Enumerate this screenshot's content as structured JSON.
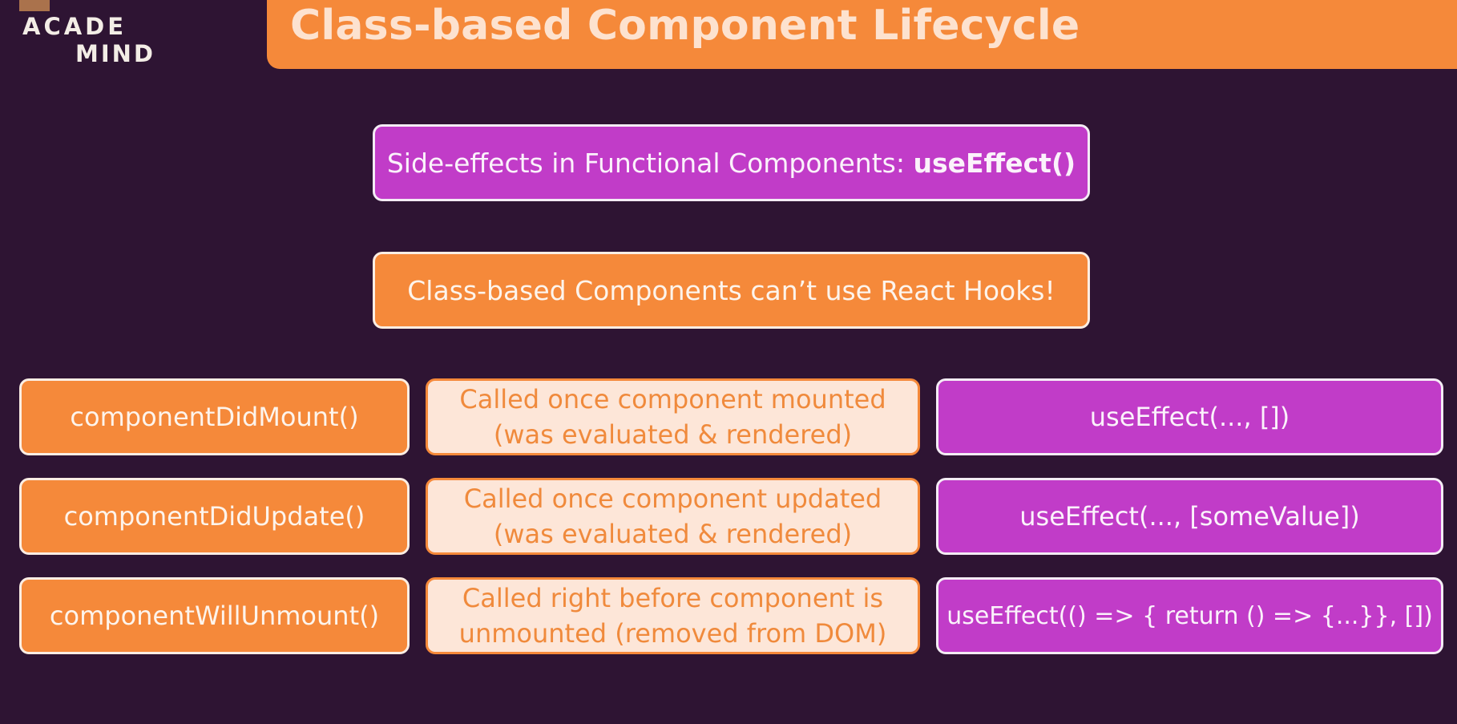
{
  "header": {
    "title": "Class-based Component Lifecycle"
  },
  "logo": {
    "line1": "ACADE",
    "line2": "MIND"
  },
  "boxes": {
    "functional_prefix": "Side-effects in Functional Components: ",
    "functional_bold": "useEffect()",
    "class_note": "Class-based Components can’t use React Hooks!"
  },
  "rows": [
    {
      "method": "componentDidMount()",
      "description_line1": "Called once component mounted",
      "description_line2": "(was evaluated & rendered)",
      "hook": "useEffect(..., [])"
    },
    {
      "method": "componentDidUpdate()",
      "description_line1": "Called once component updated",
      "description_line2": "(was evaluated & rendered)",
      "hook": "useEffect(..., [someValue])"
    },
    {
      "method": "componentWillUnmount()",
      "description_line1": "Called right before component is",
      "description_line2": "unmounted (removed from DOM)",
      "hook": "useEffect(() => { return () => {...}}, [])"
    }
  ],
  "colors": {
    "background": "#2e1433",
    "orange": "#f5893a",
    "purple": "#c13cc8",
    "light": "#fde6d8"
  }
}
